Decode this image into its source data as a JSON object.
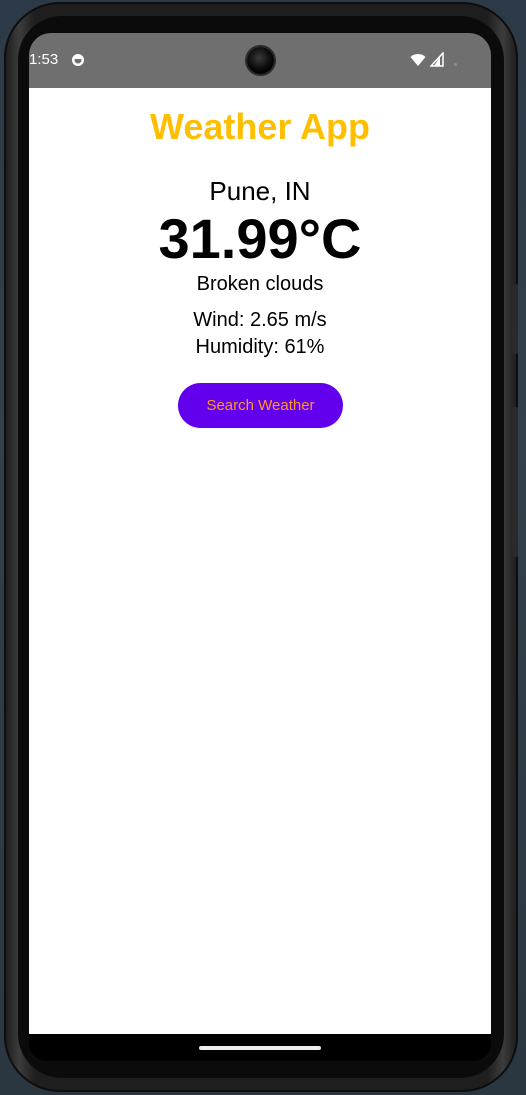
{
  "status_bar": {
    "time": "1:53",
    "icons": {
      "app": "app-notification-icon",
      "wifi": "wifi-icon",
      "signal": "cellular-signal-icon"
    }
  },
  "app": {
    "title": "Weather App",
    "title_color": "#ffbf00",
    "location": "Pune, IN",
    "temperature": "31.99°C",
    "description": "Broken clouds",
    "wind": "Wind: 2.65 m/s",
    "humidity": "Humidity: 61%",
    "search_button_label": "Search Weather",
    "button_color": "#6200ee",
    "button_text_color": "#ff9a1a"
  }
}
